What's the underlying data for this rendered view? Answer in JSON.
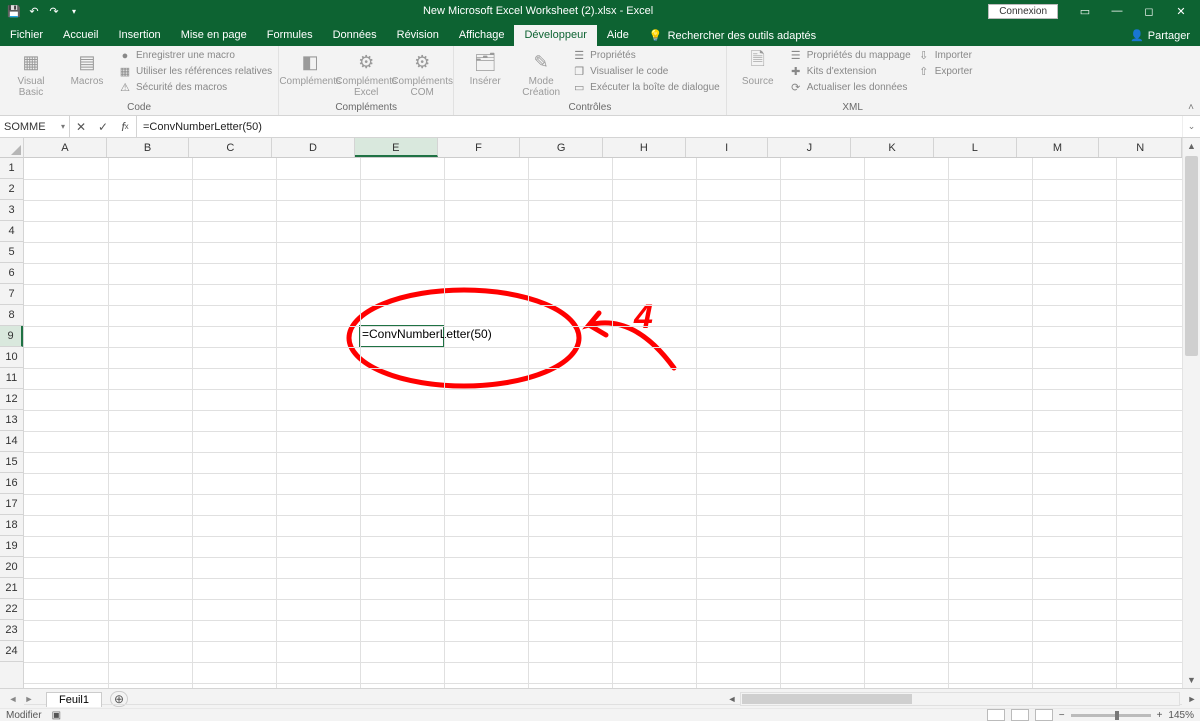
{
  "titlebar": {
    "title": "New Microsoft Excel Worksheet (2).xlsx - Excel",
    "connexion": "Connexion"
  },
  "menubar": {
    "tabs": [
      "Fichier",
      "Accueil",
      "Insertion",
      "Mise en page",
      "Formules",
      "Données",
      "Révision",
      "Affichage",
      "Développeur",
      "Aide"
    ],
    "active_index": 8,
    "search": "Rechercher des outils adaptés",
    "share": "Partager"
  },
  "ribbon": {
    "group_code": {
      "label": "Code",
      "visual_basic": "Visual\nBasic",
      "macros": "Macros",
      "rec": "Enregistrer une macro",
      "refs": "Utiliser les références relatives",
      "security": "Sécurité des macros"
    },
    "group_complements": {
      "label": "Compléments",
      "btn1": "Compléments",
      "btn2": "Compléments\nExcel",
      "btn3": "Compléments\nCOM"
    },
    "group_controles": {
      "label": "Contrôles",
      "insert": "Insérer",
      "mode": "Mode\nCréation",
      "props": "Propriétés",
      "viewcode": "Visualiser le code",
      "dialog": "Exécuter la boîte de dialogue"
    },
    "group_xml": {
      "label": "XML",
      "source": "Source",
      "mapprops": "Propriétés du mappage",
      "kits": "Kits d'extension",
      "refresh": "Actualiser les données",
      "import": "Importer",
      "export": "Exporter"
    }
  },
  "formulabar": {
    "namebox": "SOMME",
    "formula": "=ConvNumberLetter(50)"
  },
  "grid": {
    "columns": [
      "A",
      "B",
      "C",
      "D",
      "E",
      "F",
      "G",
      "H",
      "I",
      "J",
      "K",
      "L",
      "M",
      "N"
    ],
    "rows": [
      "1",
      "2",
      "3",
      "4",
      "5",
      "6",
      "7",
      "8",
      "9",
      "10",
      "11",
      "12",
      "13",
      "14",
      "15",
      "16",
      "17",
      "18",
      "19",
      "20",
      "21",
      "22",
      "23",
      "24"
    ],
    "active_col_index": 4,
    "active_row_index": 8,
    "active_cell_text": "=ConvNumberLetter(50)"
  },
  "annotation": {
    "number": "4"
  },
  "sheets": {
    "tab1": "Feuil1"
  },
  "statusbar": {
    "mode": "Modifier",
    "zoom": "145%"
  }
}
